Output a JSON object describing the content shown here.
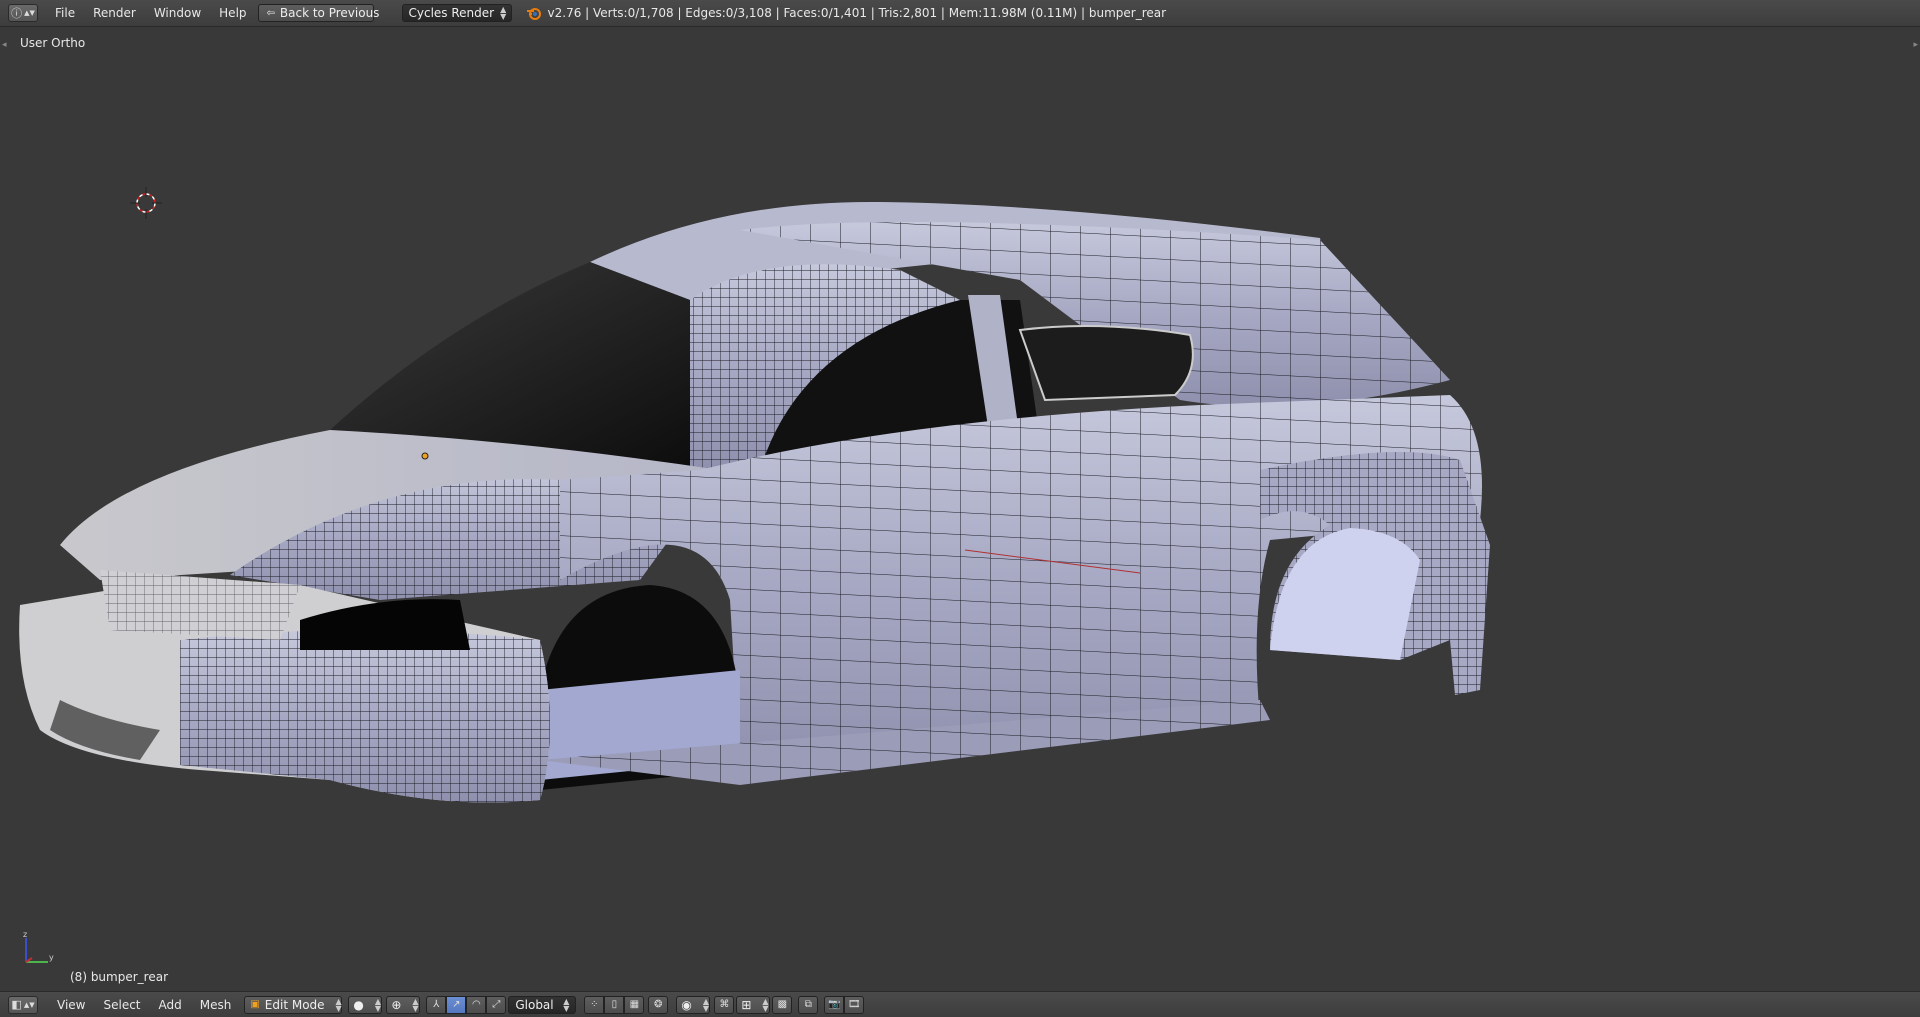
{
  "topbar": {
    "menus": [
      "File",
      "Render",
      "Window",
      "Help"
    ],
    "back_button": "Back to Previous",
    "render_engine": "Cycles Render",
    "stats": "v2.76 | Verts:0/1,708 | Edges:0/3,108 | Faces:0/1,401 | Tris:2,801 | Mem:11.98M (0.11M) | bumper_rear"
  },
  "viewport": {
    "view_label": "User Ortho",
    "object_label": "(8) bumper_rear",
    "axis_labels": {
      "z": "z",
      "y": "y"
    }
  },
  "bottombar": {
    "menus": [
      "View",
      "Select",
      "Add",
      "Mesh"
    ],
    "mode": "Edit Mode",
    "orientation": "Global"
  },
  "colors": {
    "background": "#393939",
    "header": "#444444",
    "active": "#5680c2",
    "mesh": "#b4b6cf"
  }
}
